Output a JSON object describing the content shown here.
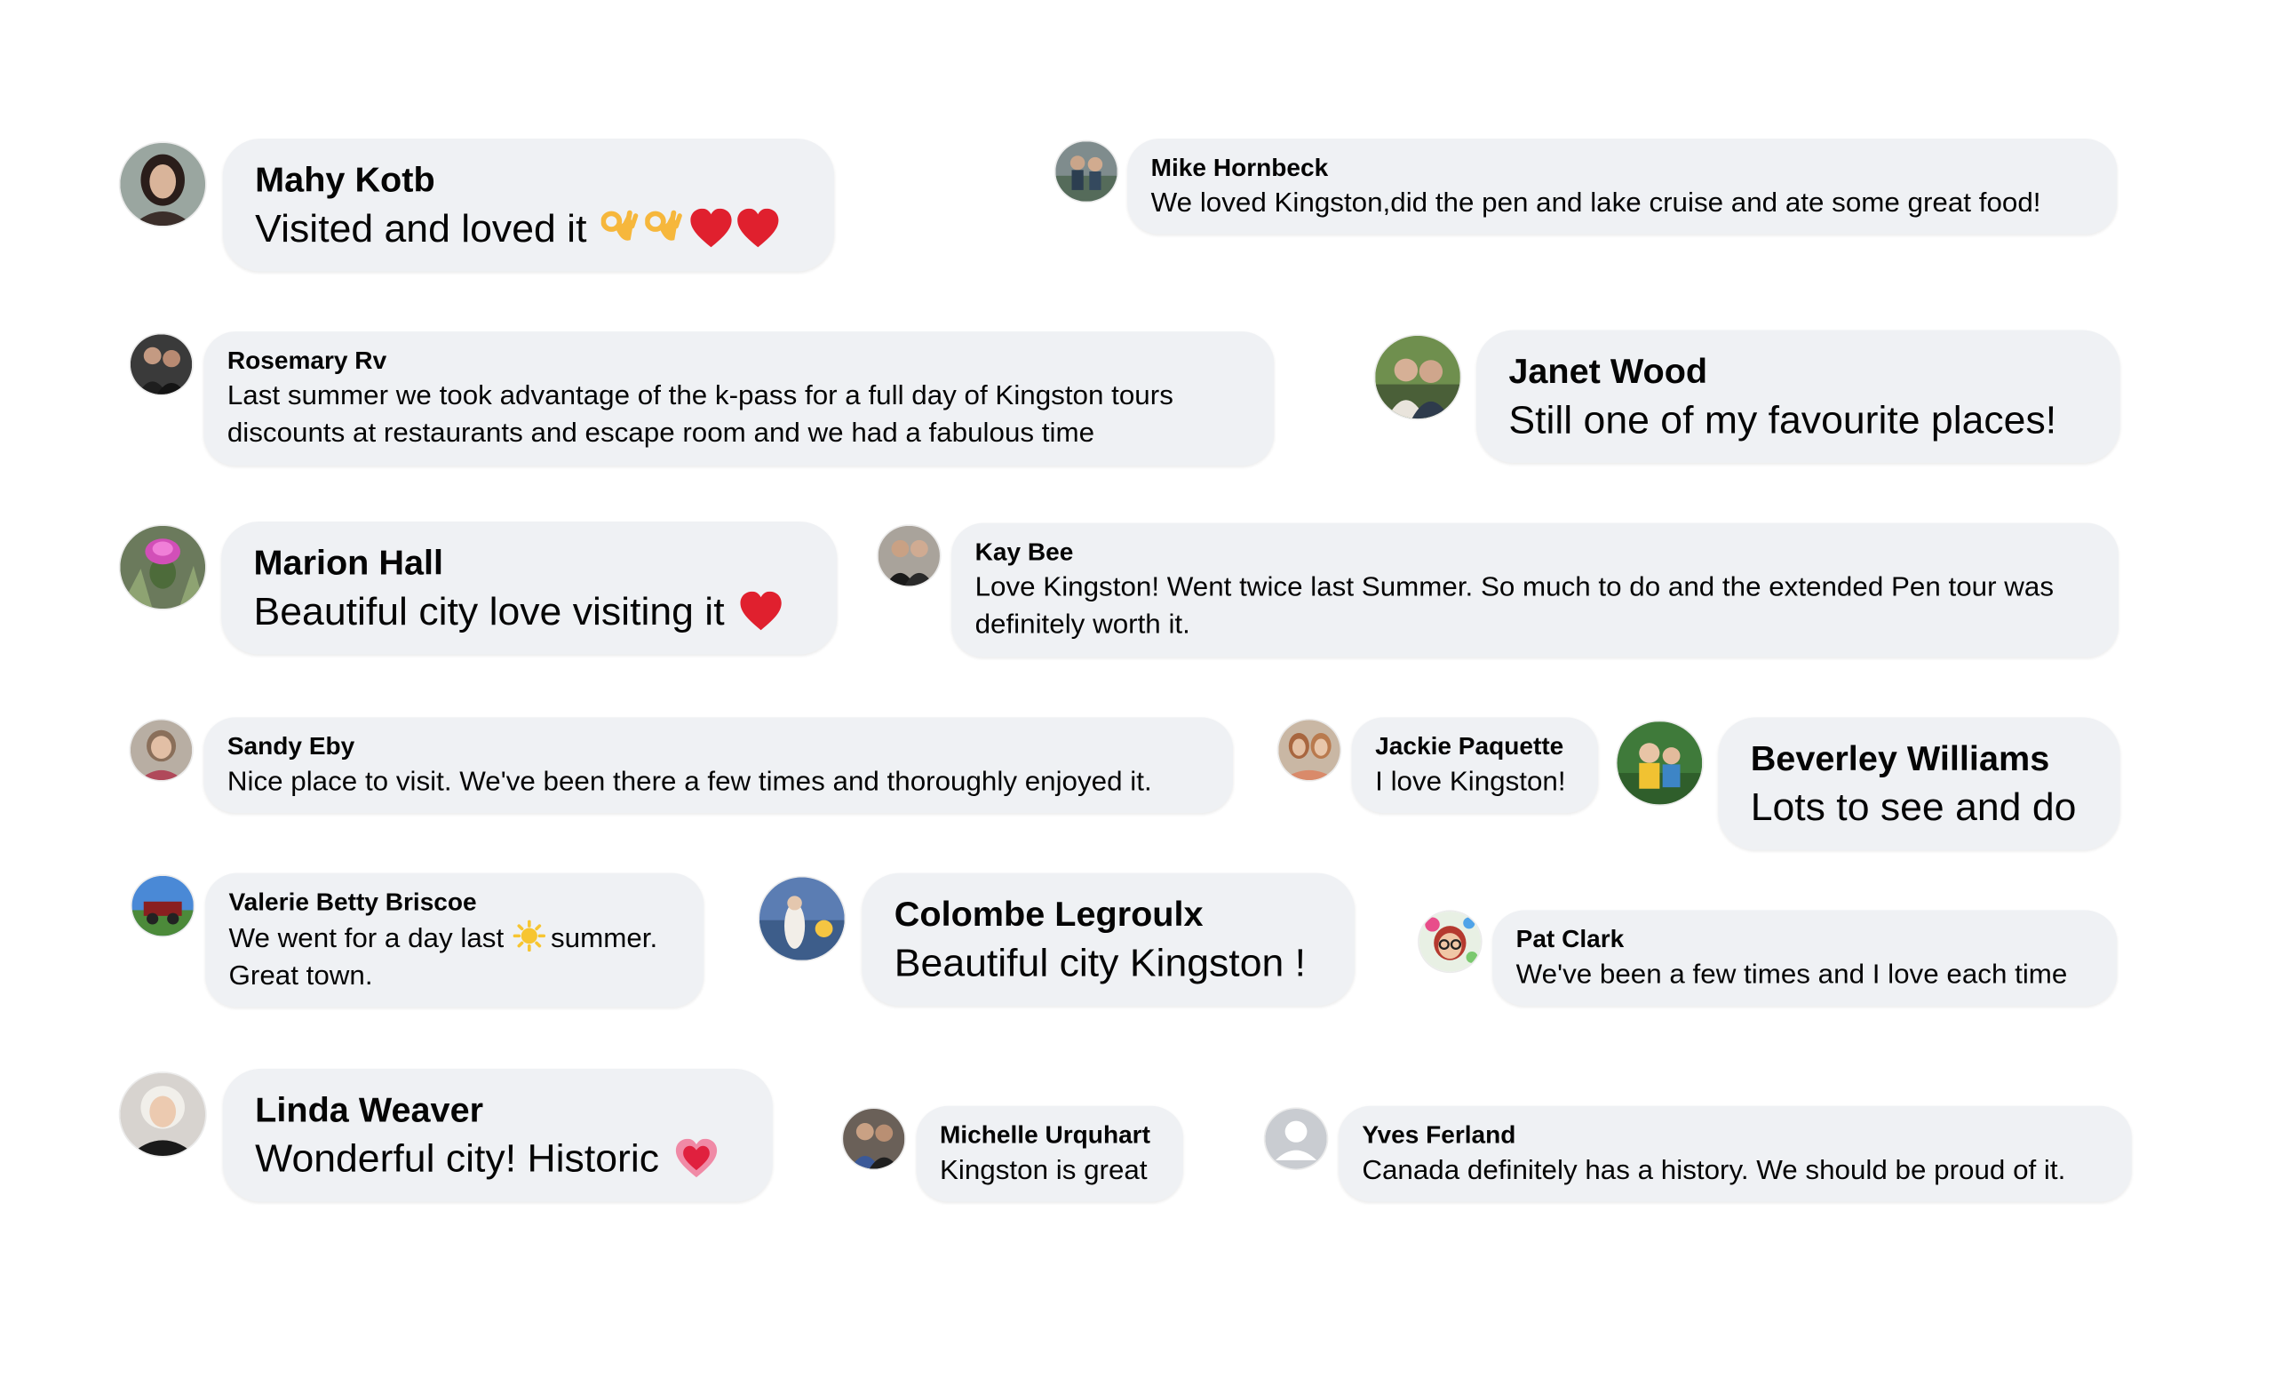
{
  "colors": {
    "background": "#ffffff",
    "bubble": "#eff1f4",
    "text": "#050505",
    "heart": "#e0202e",
    "ok_hand": "#f6b73c",
    "sun": "#f7c531"
  },
  "comments": [
    {
      "name": "Mahy Kotb",
      "text": "Visited and loved it",
      "emoji": [
        "ok-hand-icon",
        "ok-hand-icon",
        "red-heart-icon",
        "red-heart-icon"
      ]
    },
    {
      "name": "Mike Hornbeck",
      "text": "We loved Kingston,did the pen and lake cruise and ate some great food!"
    },
    {
      "name": "Rosemary Rv",
      "text": "Last summer we took advantage of the k-pass for a full day of Kingston tours discounts at restaurants and escape room and we had a fabulous time"
    },
    {
      "name": "Janet Wood",
      "text": "Still one of my favourite places!"
    },
    {
      "name": "Marion Hall",
      "text": "Beautiful city love visiting it",
      "emoji": [
        "red-heart-icon"
      ]
    },
    {
      "name": "Kay Bee",
      "text": "Love Kingston! Went twice last Summer. So much to do and the extended Pen tour was definitely worth it."
    },
    {
      "name": "Sandy Eby",
      "text": "Nice place to visit. We've been there a few times and thoroughly enjoyed it."
    },
    {
      "name": "Jackie Paquette",
      "text": "I love Kingston!"
    },
    {
      "name": "Beverley Williams",
      "text": "Lots to see and do"
    },
    {
      "name": "Valerie Betty Briscoe",
      "text_before": "We went for a day last",
      "text_after": "summer. Great town.",
      "emoji": [
        "sun-icon"
      ]
    },
    {
      "name": "Colombe Legroulx",
      "text": "Beautiful city Kingston !"
    },
    {
      "name": "Pat Clark",
      "text": "We've been a few times and I love each time"
    },
    {
      "name": "Linda Weaver",
      "text": "Wonderful city! Historic",
      "emoji": [
        "heart-with-ribbon-icon"
      ]
    },
    {
      "name": "Michelle Urquhart",
      "text": "Kingston is great"
    },
    {
      "name": "Yves Ferland",
      "text": "Canada definitely has a history. We should be proud of it."
    }
  ]
}
